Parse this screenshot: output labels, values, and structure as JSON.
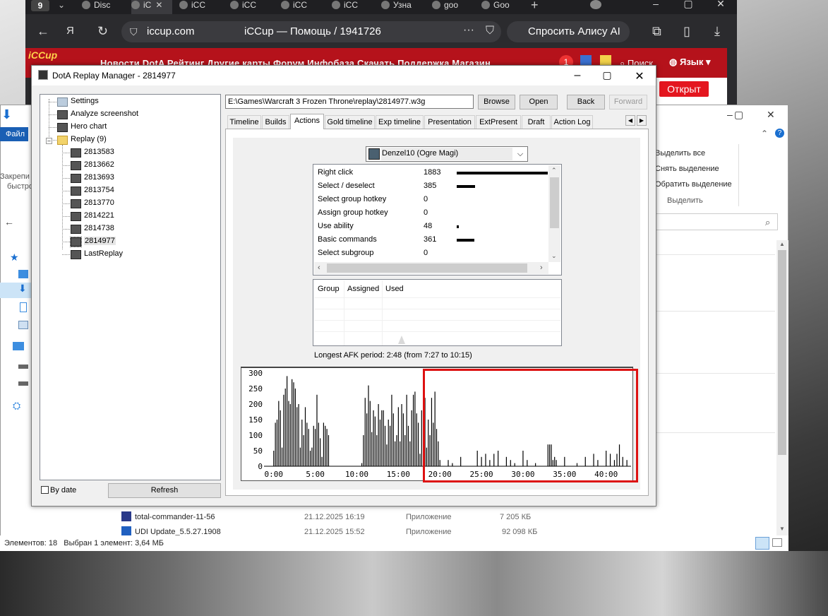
{
  "browser": {
    "tab_count": "9",
    "tabs": [
      {
        "label": "Disc",
        "icon": "discord-icon"
      },
      {
        "label": "iC",
        "icon": "iccup-icon"
      },
      {
        "label": "iCC",
        "icon": "iccup-icon"
      },
      {
        "label": "iCC",
        "icon": "iccup-icon"
      },
      {
        "label": "iCC",
        "icon": "iccup-icon"
      },
      {
        "label": "iCC",
        "icon": "iccup-icon"
      },
      {
        "label": "Узна",
        "icon": "gear-icon"
      },
      {
        "label": "goo",
        "icon": "yandex-icon"
      },
      {
        "label": "Goo",
        "icon": "google-translate-icon"
      }
    ],
    "url": "iccup.com",
    "page_title": "iCCup — Помощь / 1941726",
    "alisa_label": "Спросить Алису AI"
  },
  "site": {
    "logo": "iCCup",
    "nav": "Новости   DotA   Рейтинг   Другие карты   Форум   Инфобаза   Скачать   Поддержка       Магазин",
    "notif_count": "1",
    "search_label": "Поиск",
    "lang_label": "Язык",
    "open_label": "Открыт"
  },
  "explorer": {
    "file_tab": "Файл",
    "sidebar_labels": [
      "Закрепи",
      "быстро"
    ],
    "menu": [
      "Выделить все",
      "Снять выделение",
      "Обратить выделение"
    ],
    "menu_group": "Выделить",
    "rows": [
      {
        "name": "total-commander-11-56",
        "date": "21.12.2025 16:19",
        "type": "Приложение",
        "size": "7 205 КБ"
      },
      {
        "name": "UDI Update_5.5.27.1908",
        "date": "21.12.2025 15:52",
        "type": "Приложение",
        "size": "92 098 КБ"
      }
    ],
    "status_count": "Элементов: 18",
    "status_selected": "Выбран 1 элемент: 3,64 МБ"
  },
  "dialog": {
    "title": "DotA Replay Manager - 2814977",
    "tree": [
      {
        "label": "Settings",
        "icon": "settings-icon"
      },
      {
        "label": "Analyze screenshot",
        "icon": "screenshot-icon"
      },
      {
        "label": "Hero chart",
        "icon": "chart-icon"
      },
      {
        "label": "Replay (9)",
        "icon": "folder-icon"
      },
      {
        "label": "2813583",
        "icon": "replay-icon"
      },
      {
        "label": "2813662",
        "icon": "replay-icon"
      },
      {
        "label": "2813693",
        "icon": "replay-icon"
      },
      {
        "label": "2813754",
        "icon": "replay-icon"
      },
      {
        "label": "2813770",
        "icon": "replay-icon"
      },
      {
        "label": "2814221",
        "icon": "replay-icon"
      },
      {
        "label": "2814738",
        "icon": "replay-icon"
      },
      {
        "label": "2814977",
        "icon": "replay-icon"
      },
      {
        "label": "LastReplay",
        "icon": "replay-icon"
      }
    ],
    "by_date_label": "By date",
    "refresh_label": "Refresh",
    "path": "E:\\Games\\Warcraft 3 Frozen Throne\\replay\\2814977.w3g",
    "browse_label": "Browse",
    "open_label": "Open",
    "back_label": "Back",
    "forward_label": "Forward",
    "tabs": [
      "Timeline",
      "Builds",
      "Actions",
      "Gold timeline",
      "Exp timeline",
      "Presentation",
      "ExtPresent",
      "Draft",
      "Action Log"
    ],
    "active_tab": "Actions",
    "player": "Denzel10 (Ogre Magi)",
    "actions": [
      {
        "label": "Right click",
        "value": "1883",
        "count": 1883
      },
      {
        "label": "Select / deselect",
        "value": "385",
        "count": 385
      },
      {
        "label": "Select group hotkey",
        "value": "0",
        "count": 0
      },
      {
        "label": "Assign group hotkey",
        "value": "0",
        "count": 0
      },
      {
        "label": "Use ability",
        "value": "48",
        "count": 48
      },
      {
        "label": "Basic commands",
        "value": "361",
        "count": 361
      },
      {
        "label": "Select subgroup",
        "value": "0",
        "count": 0
      }
    ],
    "group_headers": [
      "Group",
      "Assigned",
      "Used"
    ],
    "afk": "Longest AFK period: 2:48 (from 7:27 to 10:15)"
  },
  "chart_data": {
    "type": "bar",
    "y_ticks": [
      "300",
      "250",
      "200",
      "150",
      "100",
      "50",
      "0"
    ],
    "x_ticks": [
      "0:00",
      "5:00",
      "10:00",
      "15:00",
      "20:00",
      "25:00",
      "30:00",
      "35:00",
      "40:00"
    ],
    "ylim": [
      0,
      300
    ],
    "xlim_minutes": [
      -1,
      43
    ],
    "grid": false,
    "x_minutes": [
      0.0,
      0.2,
      0.4,
      0.6,
      0.8,
      1.0,
      1.2,
      1.4,
      1.6,
      1.8,
      2.0,
      2.2,
      2.4,
      2.6,
      2.8,
      3.0,
      3.2,
      3.4,
      3.6,
      3.8,
      4.0,
      4.2,
      4.4,
      4.6,
      4.8,
      5.0,
      5.2,
      5.4,
      5.6,
      5.8,
      6.0,
      6.2,
      6.4,
      6.6,
      6.8,
      7.0,
      7.2,
      7.4,
      7.6,
      7.8,
      8.0,
      8.2,
      8.4,
      8.6,
      8.8,
      9.0,
      9.2,
      9.4,
      9.6,
      9.8,
      10.0,
      10.2,
      10.4,
      10.6,
      10.8,
      11.0,
      11.2,
      11.4,
      11.6,
      11.8,
      12.0,
      12.2,
      12.4,
      12.6,
      12.8,
      13.0,
      13.2,
      13.4,
      13.6,
      13.8,
      14.0,
      14.2,
      14.4,
      14.6,
      14.8,
      15.0,
      15.2,
      15.4,
      15.6,
      15.8,
      16.0,
      16.2,
      16.4,
      16.6,
      16.8,
      17.0,
      17.2,
      17.4,
      17.6,
      17.8,
      18.0,
      18.2,
      18.4,
      18.6,
      18.8,
      19.0,
      19.2,
      19.4,
      19.6,
      19.8,
      20.0,
      21.0,
      21.5,
      22.5,
      24.5,
      25.0,
      25.5,
      26.0,
      26.5,
      27.0,
      28.0,
      28.5,
      29.0,
      30.0,
      30.5,
      31.5,
      33.0,
      33.2,
      33.4,
      33.6,
      33.8,
      34.0,
      35.0,
      36.5,
      37.5,
      38.5,
      39.0,
      40.0,
      40.5,
      41.0,
      41.3,
      41.6,
      42.0,
      42.5
    ],
    "values": [
      50,
      140,
      150,
      210,
      180,
      60,
      230,
      250,
      290,
      210,
      200,
      280,
      270,
      250,
      190,
      200,
      60,
      150,
      100,
      190,
      140,
      120,
      50,
      60,
      130,
      120,
      230,
      140,
      90,
      30,
      140,
      130,
      120,
      100,
      0,
      0,
      0,
      0,
      0,
      0,
      0,
      0,
      0,
      0,
      0,
      0,
      0,
      0,
      0,
      0,
      0,
      0,
      0,
      10,
      100,
      220,
      170,
      260,
      210,
      110,
      180,
      160,
      100,
      200,
      150,
      180,
      180,
      130,
      70,
      150,
      130,
      230,
      170,
      80,
      100,
      190,
      80,
      200,
      170,
      100,
      230,
      130,
      80,
      180,
      230,
      240,
      170,
      140,
      40,
      180,
      200,
      220,
      60,
      150,
      100,
      220,
      140,
      240,
      120,
      80,
      20,
      20,
      10,
      30,
      50,
      30,
      40,
      20,
      40,
      50,
      30,
      20,
      10,
      50,
      20,
      10,
      70,
      70,
      70,
      20,
      30,
      20,
      30,
      10,
      30,
      40,
      20,
      50,
      40,
      20,
      40,
      70,
      30,
      20
    ]
  }
}
